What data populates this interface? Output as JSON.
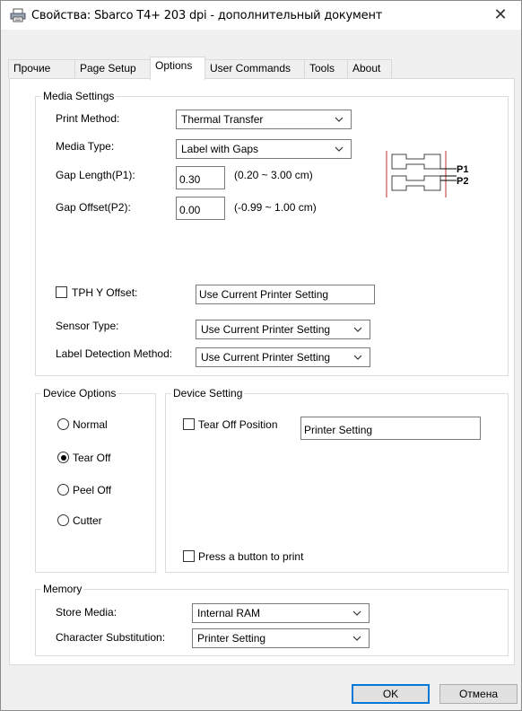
{
  "window": {
    "title": "Свойства: Sbarco T4+ 203 dpi - дополнительный документ",
    "close_glyph": "✕"
  },
  "tabs": [
    {
      "label": "Прочие",
      "active": false
    },
    {
      "label": "Page Setup",
      "active": false
    },
    {
      "label": "Options",
      "active": true
    },
    {
      "label": "User Commands",
      "active": false
    },
    {
      "label": "Tools",
      "active": false
    },
    {
      "label": "About",
      "active": false
    }
  ],
  "media_settings": {
    "title": "Media Settings",
    "print_method_label": "Print Method:",
    "print_method_value": "Thermal Transfer",
    "media_type_label": "Media Type:",
    "media_type_value": "Label with Gaps",
    "gap_length_label": "Gap Length(P1):",
    "gap_length_value": "0.30",
    "gap_length_range": "(0.20 ~ 3.00 cm)",
    "gap_offset_label": "Gap Offset(P2):",
    "gap_offset_value": "0.00",
    "gap_offset_range": "(-0.99 ~ 1.00 cm)",
    "diagram_p1": "P1",
    "diagram_p2": "P2",
    "tph_label": "TPH Y Offset:",
    "tph_checked": false,
    "tph_value": "Use Current Printer Setting",
    "sensor_label": "Sensor Type:",
    "sensor_value": "Use Current Printer Setting",
    "detection_label": "Label Detection Method:",
    "detection_value": "Use Current Printer Setting"
  },
  "device_options": {
    "title": "Device Options",
    "options": [
      {
        "label": "Normal",
        "checked": false
      },
      {
        "label": "Tear Off",
        "checked": true
      },
      {
        "label": "Peel Off",
        "checked": false
      },
      {
        "label": "Cutter",
        "checked": false
      }
    ]
  },
  "device_setting": {
    "title": "Device Setting",
    "tear_off_label": "Tear Off Position",
    "tear_off_checked": false,
    "tear_off_value": "Printer Setting",
    "press_button_label": "Press a button to print",
    "press_button_checked": false
  },
  "memory": {
    "title": "Memory",
    "store_media_label": "Store Media:",
    "store_media_value": "Internal RAM",
    "char_sub_label": "Character Substitution:",
    "char_sub_value": "Printer Setting"
  },
  "buttons": {
    "ok": "OK",
    "cancel": "Отмена"
  },
  "icons": {
    "title": "printer-icon",
    "combo": "chevron-down-icon"
  }
}
